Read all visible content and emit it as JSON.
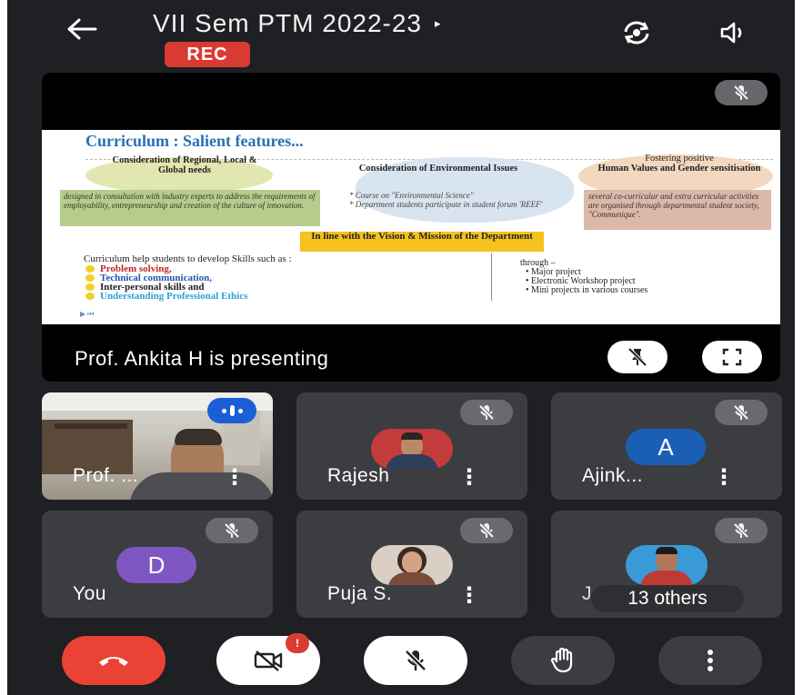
{
  "header": {
    "back_icon": "arrow-left-icon",
    "title": "VII Sem PTM 2022-23",
    "title_chevron": "▸",
    "rec_label": "REC",
    "switch_camera_icon": "switch-camera-icon",
    "speaker_icon": "speaker-icon"
  },
  "presentation": {
    "presenter_label": "Prof. Ankita H is presenting",
    "mute_icon": "mic-off-icon",
    "pin_icon": "pin-off-icon",
    "fullscreen_icon": "fullscreen-icon",
    "slide": {
      "title": "Curriculum :  Salient features...",
      "feature_1_title": "Consideration of Regional, Local & Global needs",
      "feature_1_text": "designed in consultation with industry experts to address the requirements of employability, entrepreneurship and creation of the culture of innovation.",
      "feature_2_title": "Consideration of Environmental Issues",
      "feature_2_note_1": "* Course on \"Environmental Science\"",
      "feature_2_note_2": "* Department students participate in student forum 'REEF'",
      "feature_3_title_pre": "Fostering positive",
      "feature_3_title": "Human Values and Gender sensitisation",
      "feature_3_text": "several co-curricular and extra curricular activities are organised through departmental student society, \"Communique\".",
      "vision_box": "In line with the Vision & Mission of the Department",
      "skills_intro": "Curriculum help students to develop Skills such as :",
      "skills": [
        "Problem solving,",
        "Technical communication,",
        "Inter-personal skills and",
        "Understanding Professional Ethics"
      ],
      "through_label": "through –",
      "through_items": [
        "Major project",
        "Electronic Workshop project",
        "Mini projects in various courses"
      ],
      "nav_hint": "▶ ⏮"
    }
  },
  "participants": [
    {
      "name": "Prof. ...",
      "type": "video",
      "speaking": true
    },
    {
      "name": "Rajesh",
      "type": "photo",
      "muted": true
    },
    {
      "name": "Ajink...",
      "type": "letter",
      "letter": "A",
      "color": "#1a5fb4",
      "muted": true
    },
    {
      "name": "You",
      "type": "letter",
      "letter": "D",
      "color": "#7e57c2",
      "muted": true
    },
    {
      "name": "Puja S.",
      "type": "photo",
      "muted": true
    },
    {
      "name": "Jagdish P.",
      "type": "photo",
      "muted": true,
      "others_label": "13 others"
    }
  ],
  "controls": {
    "end_call_icon": "end-call-icon",
    "camera_icon": "camera-off-icon",
    "camera_alert": "!",
    "mic_icon": "mic-off-icon",
    "hand_icon": "raise-hand-icon",
    "more_icon": "more-vert-icon"
  },
  "colors": {
    "background": "#1f2023",
    "tile": "#3c3d40",
    "rec": "#d93b32",
    "end_call": "#ea4335",
    "speaking": "#1a5fd6"
  }
}
